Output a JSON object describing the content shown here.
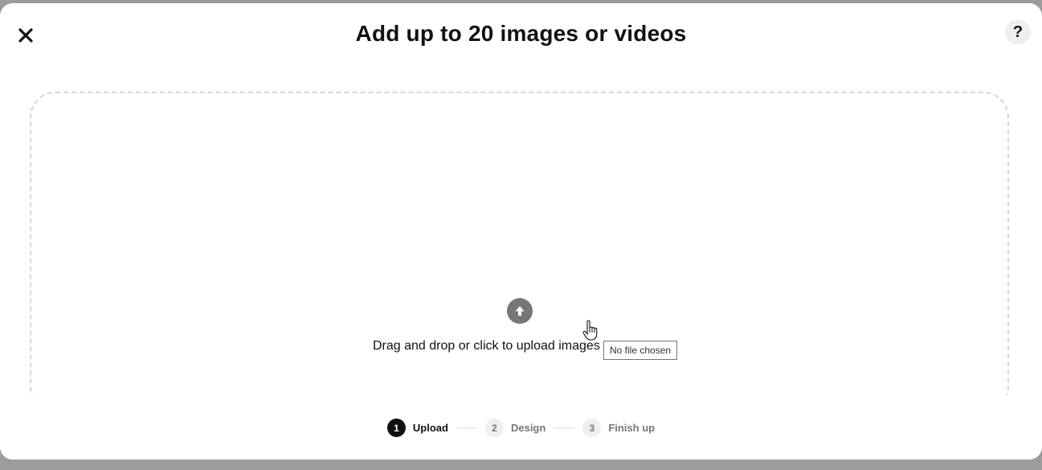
{
  "modal": {
    "title": "Add up to 20 images or videos",
    "help_label": "?"
  },
  "dropzone": {
    "text": "Drag and drop or click to upload images",
    "file_status": "No file chosen"
  },
  "steps": [
    {
      "number": "1",
      "label": "Upload",
      "active": true
    },
    {
      "number": "2",
      "label": "Design",
      "active": false
    },
    {
      "number": "3",
      "label": "Finish up",
      "active": false
    }
  ],
  "colors": {
    "backdrop": "#9c9c9c",
    "active_step": "#111111",
    "inactive_step": "#767676",
    "upload_icon": "#767676",
    "dashed_border": "#d6d6d6"
  }
}
